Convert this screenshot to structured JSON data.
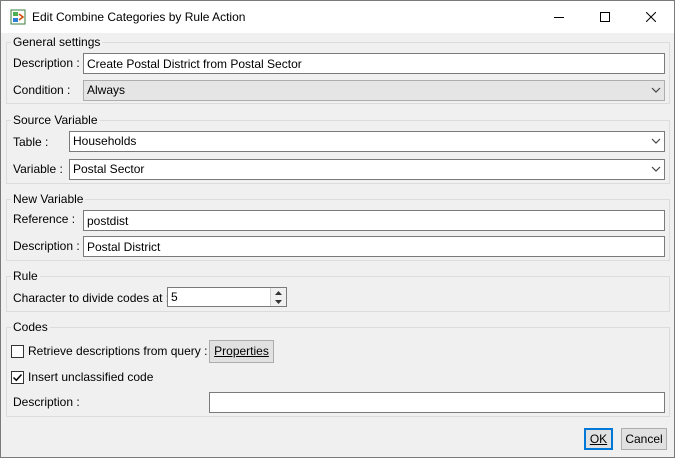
{
  "window": {
    "title": "Edit Combine Categories by Rule Action",
    "icons": {
      "app": "combine-rule-icon",
      "minimize": "minimize-icon",
      "maximize": "maximize-icon",
      "close": "close-icon"
    }
  },
  "general": {
    "title": "General settings",
    "description_label": "Description :",
    "description_value": "Create Postal District from Postal Sector",
    "condition_label": "Condition :",
    "condition_value": "Always"
  },
  "source": {
    "title": "Source Variable",
    "table_label": "Table :",
    "table_value": "Households",
    "variable_label": "Variable :",
    "variable_value": "Postal Sector"
  },
  "new_variable": {
    "title": "New Variable",
    "reference_label": "Reference :",
    "reference_value": "postdist",
    "description_label": "Description :",
    "description_value": "Postal District"
  },
  "rule": {
    "title": "Rule",
    "divide_label": "Character to divide codes at :",
    "divide_value": "5"
  },
  "codes": {
    "title": "Codes",
    "retrieve_label": "Retrieve descriptions from query :",
    "retrieve_checked": false,
    "properties_label": "Properties",
    "insert_label": "Insert unclassified code",
    "insert_checked": true,
    "description_label": "Description :",
    "description_value": ""
  },
  "buttons": {
    "ok_label": "OK",
    "cancel_label": "Cancel"
  },
  "colors": {
    "default_button_border": "#0078d7",
    "dialog_bg": "#f0f0f0",
    "disabled_combo_bg": "#e5e5e5"
  }
}
